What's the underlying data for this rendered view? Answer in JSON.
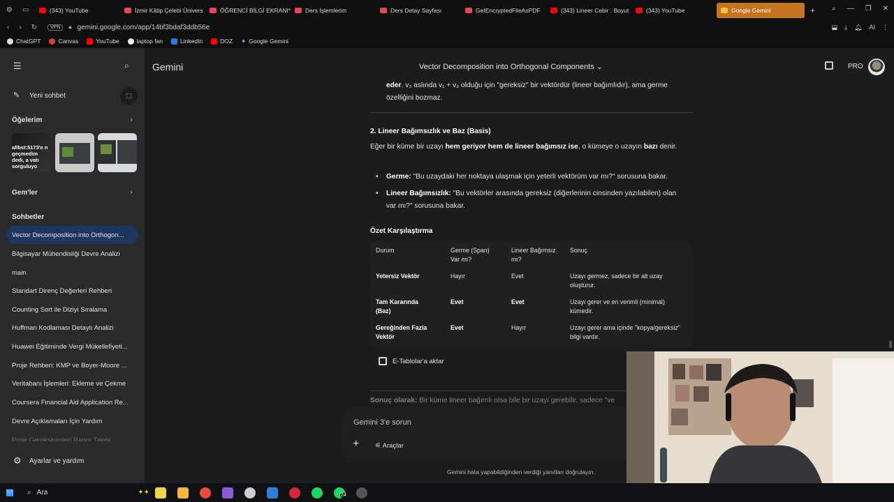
{
  "browser": {
    "tabs": [
      {
        "label": "(343) YouTube",
        "color": "#ff0000"
      },
      {
        "label": "İzmir Kâtip Çelebi Ünivers",
        "color": "#e8455a"
      },
      {
        "label": "ÖĞRENCİ BİLGİ EKRANI*",
        "color": "#e8455a"
      },
      {
        "label": "Ders İşlemlerim",
        "color": "#e8455a"
      },
      {
        "label": "Ders Detay Sayfası",
        "color": "#e8455a"
      },
      {
        "label": "GetEncryptedFileAsPDF",
        "color": "#e8455a"
      },
      {
        "label": "(343) Lineer Cebir : Boyut",
        "color": "#ff0000"
      },
      {
        "label": "(343) YouTube",
        "color": "#ff0000"
      },
      {
        "label": "Google Gemini",
        "color": "#f5c242"
      }
    ],
    "url": "gemini.google.com/app/14bf3bdaf3ddb56e",
    "vpn_badge": "VPN",
    "ai_label": "AI",
    "bookmarks": [
      "ChatGPT",
      "Canvas",
      "YouTube",
      "laptop fan",
      "LinkedIn",
      "DOZ",
      "Google Gemini"
    ]
  },
  "sidebar": {
    "new_chat": "Yeni sohbet",
    "my_items": "Öğelerim",
    "thumb_text": "allbst:5173'e n geçmedim dedi, a vatı sorguluyo",
    "gems": "Gem'ler",
    "chats_header": "Sohbetler",
    "chats": [
      "Vector Decomposition into Orthogon...",
      "Bilgisayar Mühendisliği Devre Analizi",
      "main",
      "Standart Direnç Değerleri Rehberi",
      "Counting Sort ile Diziyi Sıralama",
      "Huffman Kodlaması Detaylı Analizi",
      "Huawei Eğitiminde Vergi Mükellefiyeti...",
      "Proje Rehberi: KMP ve Boyer-Moore ...",
      "Veritabanı İşlemleri: Ekleme ve Çekme",
      "Coursera Financial Aid Application Re...",
      "Devre Açıklamaları İçin Yardım",
      "Proje Gereksinimleri Rapor Talebi"
    ],
    "settings": "Ayarlar ve yardım"
  },
  "header": {
    "brand": "Gemini",
    "conversation_title": "Vector Decomposition into Orthogonal Components",
    "pro": "PRO"
  },
  "content": {
    "intro_bold": "eder",
    "intro_rest": ". v₃ aslında v₁ + v₂ olduğu için \"gereksiz\" bir vektördür (lineer bağımlıdır), ama germe özelliğini bozmaz.",
    "section2_title": "2. Lineer Bağımsızlık ve Baz (Basis)",
    "section2_p1": "Eğer bir küme bir uzayı ",
    "section2_p1_bold": "hem geriyor hem de lineer bağımsız ise",
    "section2_p1_mid": ", o kümeye o uzayın ",
    "section2_p1_bold2": "bazı",
    "section2_p1_end": " denir.",
    "bullet1_bold": "Germe:",
    "bullet1_text": " \"Bu uzaydaki her noktaya ulaşmak için yeterli vektörüm var mı?\" sorusuna bakar.",
    "bullet2_bold": "Lineer Bağımsızlık:",
    "bullet2_text": " \"Bu vektörler arasında gereksiz (diğerlerinin cinsinden yazılabilen) olan var mı?\" sorusuna bakar.",
    "summary_title": "Özet Karşılaştırma",
    "table": {
      "headers": [
        "Durum",
        "Germe (Span) Var mı?",
        "Lineer Bağımsız mı?",
        "Sonuç"
      ],
      "rows": [
        [
          "Yetersiz Vektör",
          "Hayır",
          "Evet",
          "Uzayı germez, sadece bir alt uzay oluşturur."
        ],
        [
          "Tam Kararında (Baz)",
          "Evet",
          "Evet",
          "Uzayı gerer ve en verimli (minimal) kümedir."
        ],
        [
          "Gereğinden Fazla Vektör",
          "Evet",
          "Hayır",
          "Uzayı gerer ama içinde \"kopya/gereksiz\" bilgi vardır."
        ]
      ]
    },
    "export_label": "E-Tablolar'a aktar",
    "conclusion_bold": "Sonuç olarak:",
    "conclusion_text": " Bir küme lineer bağımlı olsa bile bir uzayı gerebilir, sadece \"ve"
  },
  "input": {
    "placeholder": "Gemini 3'e sorun",
    "tools": "Araçlar"
  },
  "disclaimer": "Gemini hata yapabildiğinden verdiği yanıtları doğrulayın.",
  "taskbar": {
    "search": "Ara",
    "whatsapp_badge": "24"
  }
}
